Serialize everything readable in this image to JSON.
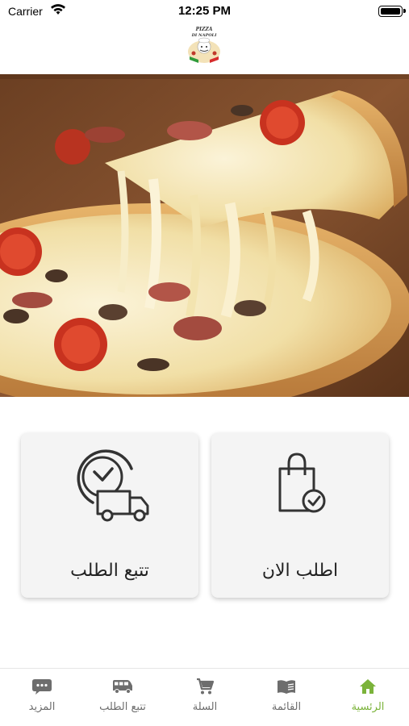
{
  "status_bar": {
    "carrier": "Carrier",
    "time": "12:25 PM"
  },
  "logo": {
    "line1": "PIZZA",
    "line2": "DI NAPOLI"
  },
  "cards": {
    "order_now": "اطلب الان",
    "track_order": "تتبع الطلب"
  },
  "tabs": [
    {
      "label": "الرئسية",
      "icon": "home-icon",
      "active": true
    },
    {
      "label": "القائمة",
      "icon": "menu-book-icon",
      "active": false
    },
    {
      "label": "السلة",
      "icon": "cart-icon",
      "active": false
    },
    {
      "label": "تتبع الطلب",
      "icon": "bus-icon",
      "active": false
    },
    {
      "label": "المزيد",
      "icon": "more-icon",
      "active": false
    }
  ],
  "colors": {
    "accent": "#7bb33a",
    "inactive": "#6d6d6d",
    "card_bg": "#f4f4f4"
  }
}
